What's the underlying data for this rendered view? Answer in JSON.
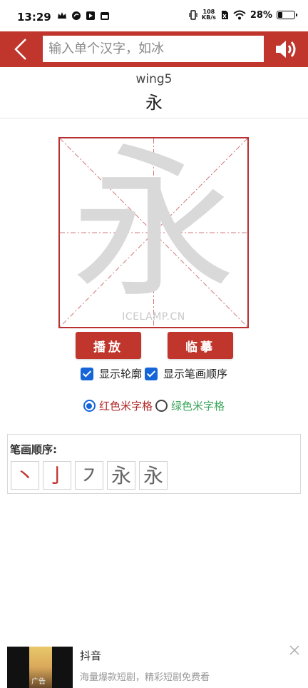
{
  "status_bar": {
    "time": "13:29",
    "net_speed_value": "108",
    "net_speed_unit": "KB/s",
    "battery": "28%",
    "battery_level": 0.28
  },
  "header": {
    "search_placeholder": "输入单个汉字，如冰",
    "accent_color": "#c0362c"
  },
  "character": {
    "pinyin": "wing5",
    "hanzi": "永",
    "watermark": "ICELAMP.CN"
  },
  "controls": {
    "play_label": "播放",
    "trace_label": "临摹",
    "show_outline_label": "显示轮廓",
    "show_outline_checked": true,
    "show_order_label": "显示笔画顺序",
    "show_order_checked": true,
    "red_grid_label": "红色米字格",
    "red_grid_selected": true,
    "green_grid_label": "绿色米字格",
    "green_grid_selected": false
  },
  "stroke_order": {
    "title": "笔画顺序:",
    "cells": [
      "丶",
      "亅",
      "㇇",
      "永",
      "永"
    ]
  },
  "ad": {
    "title": "抖音",
    "description": "海量爆款短剧，精彩短剧免费看",
    "tag": "广告"
  }
}
